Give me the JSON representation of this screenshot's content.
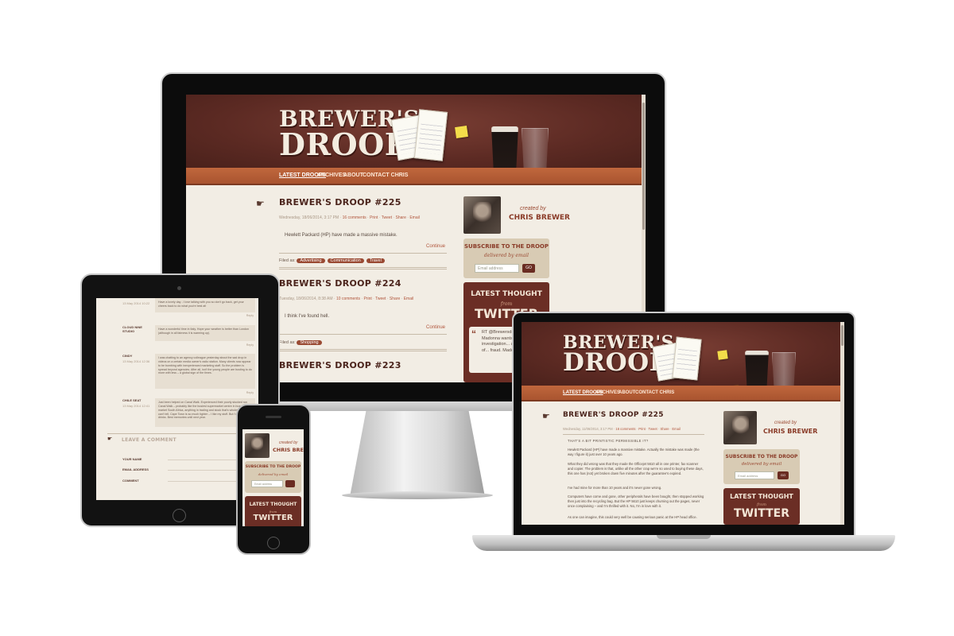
{
  "site": {
    "logo_line1": "BREWER'S",
    "logo_line2": "DROOP",
    "nav": [
      "LATEST DROOPS",
      "ARCHIVES",
      "ABOUT",
      "CONTACT CHRIS"
    ]
  },
  "desktop": {
    "posts": [
      {
        "title": "BREWER'S DROOP #225",
        "date": "Wednesday, 18/06/2014, 3:17 PM",
        "comments": "16 comments",
        "actions": [
          "Print",
          "Tweet",
          "Share",
          "Email"
        ],
        "excerpt": "Hewlett Packard (HP) have made a massive mistake.",
        "continue": "Continue",
        "filed_label": "Filed as:",
        "tags": [
          "Advertising",
          "Communication",
          "Travel"
        ]
      },
      {
        "title": "BREWER'S DROOP #224",
        "date": "Tuesday, 18/06/2014, 8:38 AM",
        "comments": "10 comments",
        "actions": [
          "Print",
          "Tweet",
          "Share",
          "Email"
        ],
        "excerpt": "I think I've found hell.",
        "continue": "Continue",
        "filed_label": "Filed as:",
        "tags": [
          "Shopping"
        ]
      },
      {
        "title": "BREWER'S DROOP #223"
      }
    ]
  },
  "sidebar": {
    "created_by": "created by",
    "author": "CHRIS BREWER",
    "subscribe_title": "SUBSCRIBE TO THE DROOP",
    "subscribe_sub": "delivered by email",
    "email_placeholder": "Email address",
    "go_label": "GO",
    "latest_title": "LATEST THOUGHT",
    "latest_from": "from",
    "latest_source": "TWITTER",
    "tweet_text": "RT @Brewersdroop: Madonna wants to... investigation... appointment of... fraud. Madonna... BND!"
  },
  "laptop": {
    "post_title": "BREWER'S DROOP #225",
    "date": "Wednesday, 11/06/2014, 3:17 PM",
    "comments": "16 comments",
    "actions": [
      "Print",
      "Tweet",
      "Share",
      "Email"
    ],
    "subhead": "THAT'S A BIT PRINTISTIC PERMISSIBLE IT?",
    "paragraphs": [
      "Hewlett Packard (HP) have made a massive mistake. Actually the mistake was made (the way I figure it) just over 10 years ago.",
      "What they did wrong was that they made the Officejet 5610 all in one printer, fax scanner and copier. The problem is that, unlike all the other crap we're so used to buying these days, this one has (not) yet broken down five minutes after the guarantee's expired.",
      "I've had mine for more than 10 years and it's never gone wrong.",
      "Computers have come and gone, other peripherals have been bought, then stopped working then just into the recycling bag. But the HP 5610 just keeps churning out the pages, never once complaining – and I'm thrilled with it. No, I'm in love with it.",
      "As one can imagine, this could very well be causing serious panic at the HP head office."
    ]
  },
  "tablet": {
    "comments": [
      {
        "name": "",
        "date": "13 May 2014 10:22",
        "text": "Have a lovely day - I love talking with you so don't go back, get your cheers back to do what you're best at!",
        "reply": "Reply"
      },
      {
        "name": "CLOUD NINE STUDIO",
        "date": "",
        "text": "Have a wonderful time in Italy. Hope your weather is better than London (although in all fairness it is warming up).",
        "reply": "Reply"
      },
      {
        "name": "CINDY",
        "date": "13 May 2014 12:36",
        "text": "I was chatting to an agency colleague yesterday about the sad drop in videos on a certain media owner's radio station. Many clients now appear to be bombing with inexperienced marketing staff. So the problem is spread beyond agencies. After all, isn't the young people are busting to do more with less – a global sign of the times.",
        "reply": "Reply"
      },
      {
        "name": "CHILE SEAT",
        "date": "13 May 2014 12:41",
        "text": "Just been helped on Canal Walk. Experienced their poorly stocked run Canal Walk – probably like the busiest supermarket centre in busy retail market South Africa, anything in trading and stock that's wholesale stock. I can't tell. Cape Town is so much tighter – I like my stuff. But I'd like my drinks. Best memories until next year.",
        "reply": "Reply"
      }
    ],
    "leave_comment": "LEAVE A COMMENT",
    "fields": [
      "YOUR NAME",
      "EMAIL ADDRESS",
      "COMMENT"
    ]
  },
  "phone": {
    "created_by": "created by",
    "author": "CHRIS BREW",
    "subscribe_title": "SUBSCRIBE TO THE DROOP",
    "subscribe_sub": "delivered by email",
    "email_placeholder": "Email address",
    "latest_title": "LATEST THOUGHT",
    "latest_from": "from",
    "latest_source": "TWITTER"
  },
  "colors": {
    "header_brown": "#5c2a23",
    "nav_orange": "#b45c34",
    "paper": "#f2ede4",
    "accent": "#9a4a33"
  }
}
